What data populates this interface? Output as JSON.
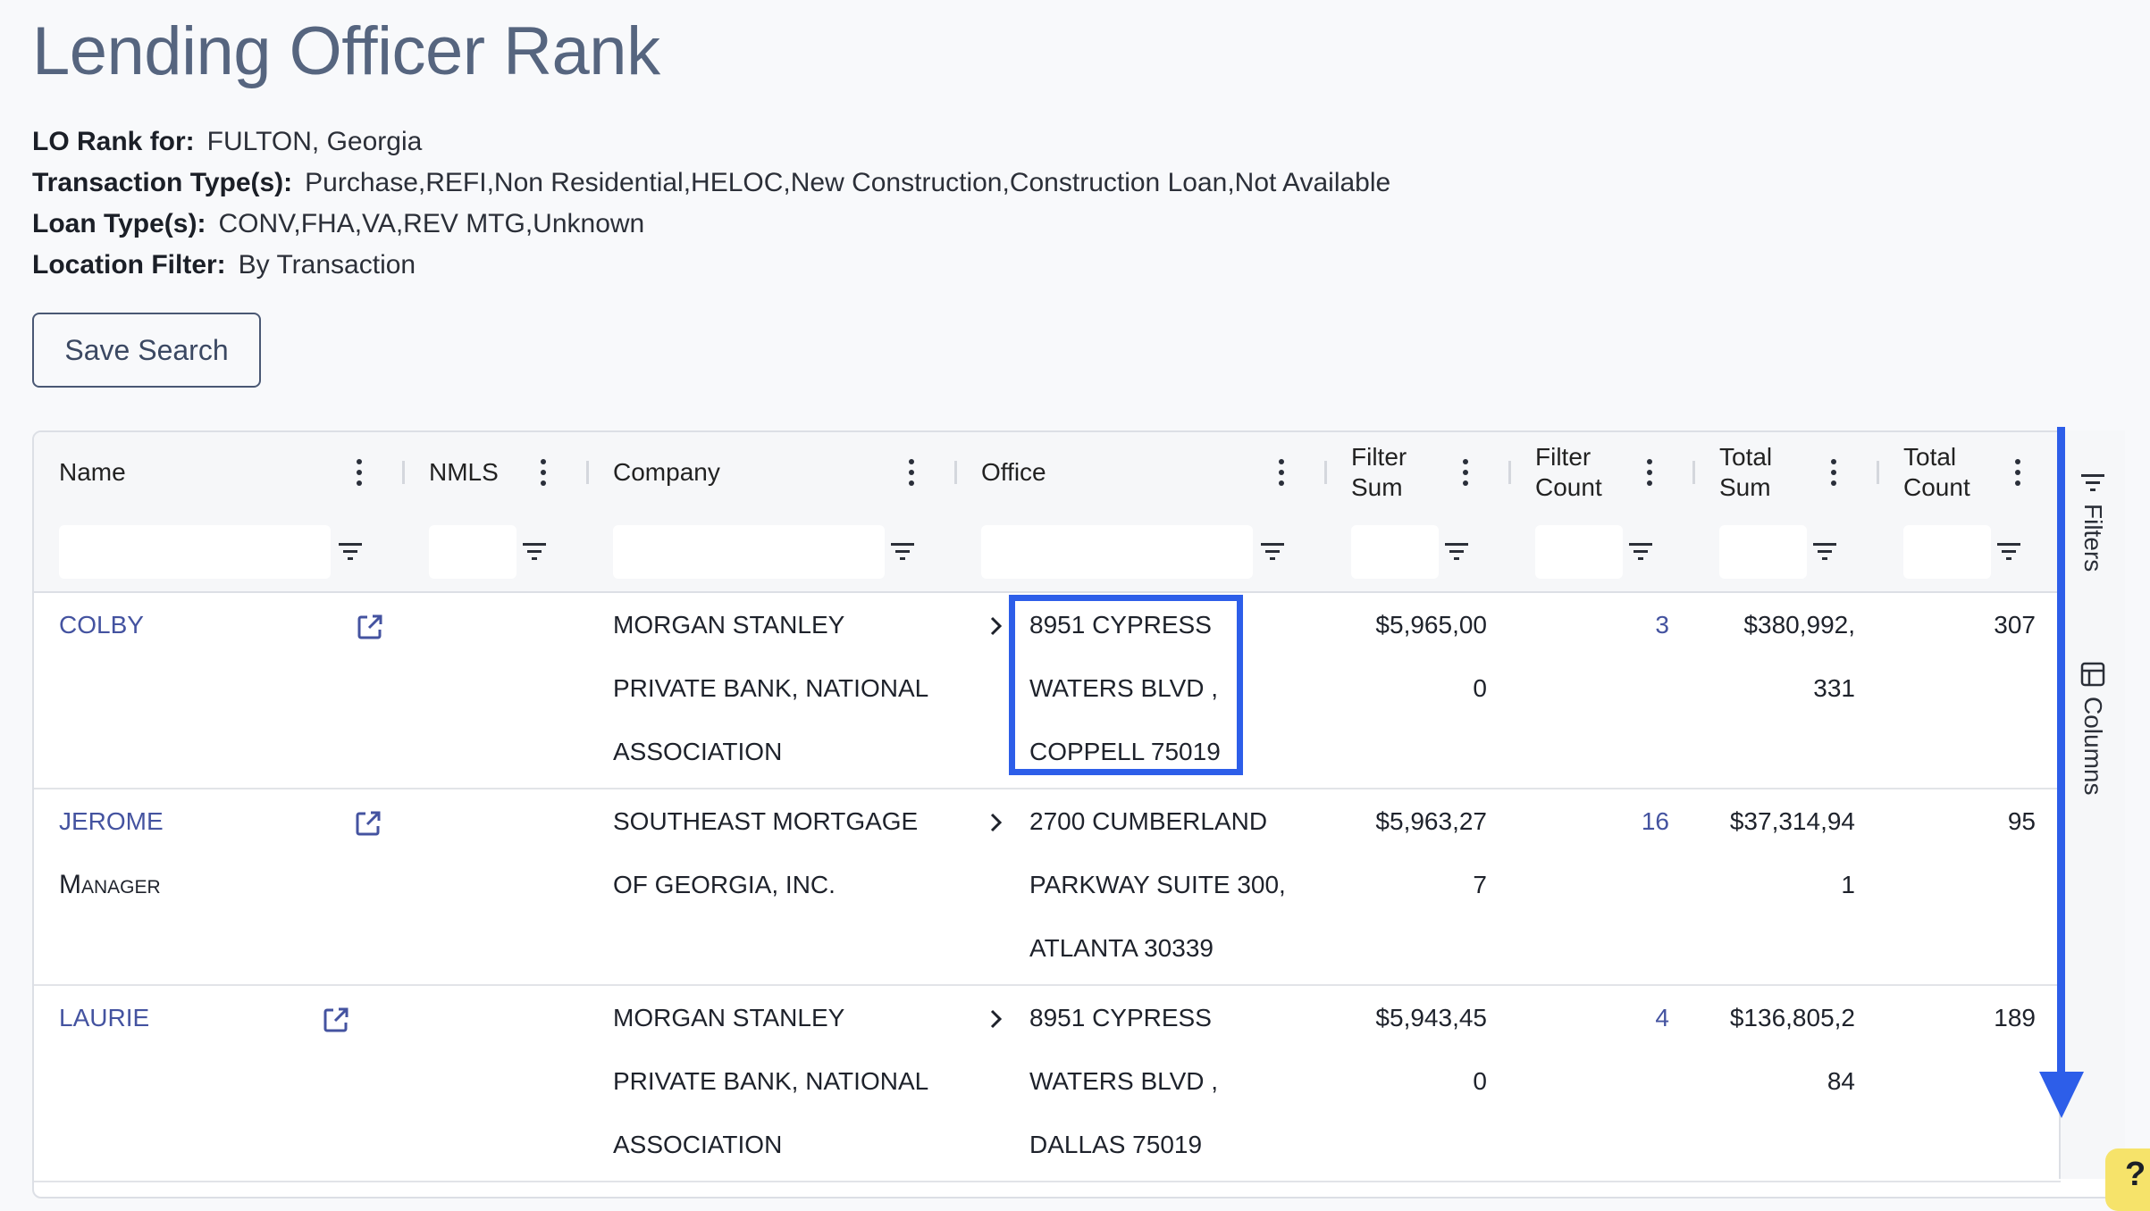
{
  "page": {
    "title": "Lending Officer Rank"
  },
  "criteria": [
    {
      "label": "LO Rank for:",
      "value": "FULTON, Georgia"
    },
    {
      "label": "Transaction Type(s):",
      "value": "Purchase,REFI,Non Residential,HELOC,New Construction,Construction Loan,Not Available"
    },
    {
      "label": "Loan Type(s):",
      "value": "CONV,FHA,VA,REV MTG,Unknown"
    },
    {
      "label": "Location Filter:",
      "value": "By Transaction"
    }
  ],
  "save_button": "Save Search",
  "columns": [
    {
      "label": "Name"
    },
    {
      "label": "NMLS"
    },
    {
      "label": "Company"
    },
    {
      "label": "Office"
    },
    {
      "label": "Filter Sum",
      "line1": "Filter",
      "line2": "Sum"
    },
    {
      "label": "Filter Count",
      "line1": "Filter",
      "line2": "Count"
    },
    {
      "label": "Total Sum",
      "line1": "Total",
      "line2": "Sum"
    },
    {
      "label": "Total Count",
      "line1": "Total",
      "line2": "Count"
    }
  ],
  "rows": [
    {
      "name": "COLBY",
      "subtitle": "",
      "company_lines": [
        "MORGAN STANLEY",
        "PRIVATE BANK, NATIONAL",
        "ASSOCIATION"
      ],
      "office_lines": [
        "8951 CYPRESS",
        "WATERS BLVD ,",
        "COPPELL 75019"
      ],
      "filter_sum_lines": [
        "$5,965,00",
        "0"
      ],
      "filter_count": "3",
      "total_sum_lines": [
        "$380,992,",
        "331"
      ],
      "total_count": "307"
    },
    {
      "name": "JEROME",
      "subtitle": "Manager",
      "company_lines": [
        "SOUTHEAST MORTGAGE",
        "OF GEORGIA, INC."
      ],
      "office_lines": [
        "2700 CUMBERLAND",
        "PARKWAY SUITE 300,",
        "ATLANTA 30339"
      ],
      "filter_sum_lines": [
        "$5,963,27",
        "7"
      ],
      "filter_count": "16",
      "total_sum_lines": [
        "$37,314,94",
        "1"
      ],
      "total_count": "95"
    },
    {
      "name": "LAURIE",
      "subtitle": "",
      "company_lines": [
        "MORGAN STANLEY",
        "PRIVATE BANK, NATIONAL",
        "ASSOCIATION"
      ],
      "office_lines": [
        "8951 CYPRESS",
        "WATERS BLVD ,",
        "DALLAS 75019"
      ],
      "filter_sum_lines": [
        "$5,943,45",
        "0"
      ],
      "filter_count": "4",
      "total_sum_lines": [
        "$136,805,2",
        "84"
      ],
      "total_count": "189"
    }
  ],
  "side_panel": {
    "filters": "Filters",
    "columns": "Columns"
  },
  "help_badge": "?",
  "colors": {
    "accent": "#2d5ee9",
    "link": "#4453a0",
    "title": "#56657f"
  }
}
